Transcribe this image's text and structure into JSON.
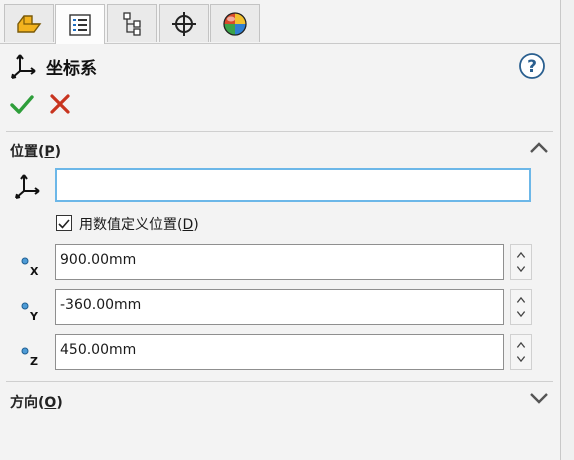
{
  "tabs": [
    {
      "name": "feature-manager-tab",
      "icon": "part-icon"
    },
    {
      "name": "property-manager-tab",
      "icon": "property-list-icon",
      "active": true
    },
    {
      "name": "configuration-manager-tab",
      "icon": "configuration-tree-icon"
    },
    {
      "name": "dimxpert-manager-tab",
      "icon": "crosshair-icon"
    },
    {
      "name": "display-manager-tab",
      "icon": "appearance-sphere-icon"
    }
  ],
  "header": {
    "title": "坐标系",
    "icon": "coordinate-system-icon"
  },
  "actions": {
    "ok_icon": "checkmark-icon",
    "cancel_icon": "close-icon",
    "help_icon": "help-icon"
  },
  "position_section": {
    "title": "位置(",
    "title_key": "P",
    "title_end": ")",
    "expanded": true,
    "reference_value": "",
    "use_numeric": {
      "checked": true,
      "label": "用数值定义位置(",
      "key": "D",
      "label_end": ")"
    },
    "fields": [
      {
        "axis": "X",
        "value": "900.00mm"
      },
      {
        "axis": "Y",
        "value": "-360.00mm"
      },
      {
        "axis": "Z",
        "value": "450.00mm"
      }
    ]
  },
  "orientation_section": {
    "title": "方向(",
    "title_key": "O",
    "title_end": ")",
    "expanded": false
  },
  "colors": {
    "accent_blue": "#6cb7e8",
    "ok_green": "#2e9e3a",
    "cancel_red": "#c8341f"
  }
}
